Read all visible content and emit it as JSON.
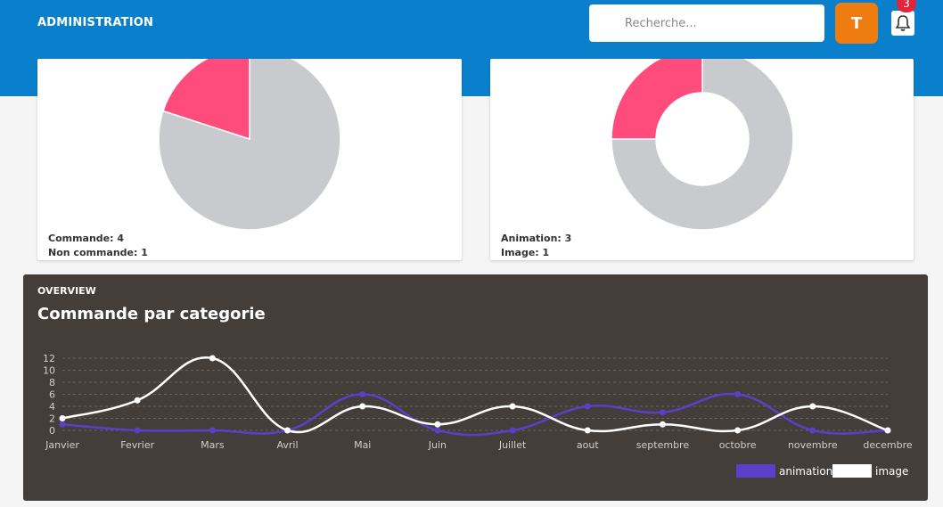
{
  "header": {
    "title": "ADMINISTRATION",
    "search_placeholder": "Recherche...",
    "avatar_initial": "T",
    "notification_count": "3",
    "bg_color": "#0a80cc"
  },
  "cards": [
    {
      "stats": [
        "Commande: 4",
        "Non commande: 1"
      ]
    },
    {
      "stats": [
        "Animation: 3",
        "Image: 1"
      ]
    }
  ],
  "overview": {
    "subtitle": "OVERVIEW",
    "title": "Commande par categorie"
  },
  "chart_data": [
    {
      "type": "pie",
      "labels": [
        "Commande",
        "Non commande"
      ],
      "values": [
        4,
        1
      ],
      "colors": [
        "#c9cacd",
        "#ff4c7d"
      ]
    },
    {
      "type": "doughnut",
      "labels": [
        "Animation",
        "Image"
      ],
      "values": [
        3,
        1
      ],
      "colors": [
        "#c9cacd",
        "#ff4c7d"
      ]
    },
    {
      "type": "line",
      "categories": [
        "Janvier",
        "Fevrier",
        "Mars",
        "Avril",
        "Mai",
        "Juin",
        "Juillet",
        "aout",
        "septembre",
        "octobre",
        "novembre",
        "decembre"
      ],
      "ylim": [
        0,
        12
      ],
      "yticks": [
        0,
        2,
        4,
        6,
        8,
        10,
        12
      ],
      "series": [
        {
          "name": "animation",
          "color": "#5a3fc8",
          "values": [
            1,
            0,
            0,
            0,
            6,
            0,
            0,
            4,
            3,
            6,
            0,
            0
          ]
        },
        {
          "name": "image",
          "color": "#ffffff",
          "values": [
            2,
            5,
            12,
            0,
            4,
            1,
            4,
            0,
            1,
            0,
            4,
            0
          ]
        }
      ],
      "legend": "bottom-right"
    }
  ]
}
